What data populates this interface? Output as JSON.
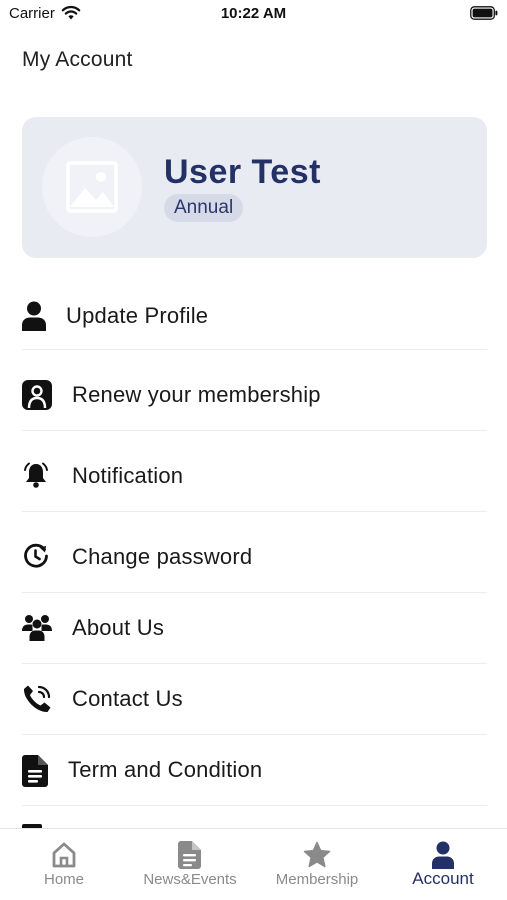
{
  "status_bar": {
    "carrier": "Carrier",
    "time": "10:22 AM"
  },
  "page": {
    "title": "My Account"
  },
  "profile": {
    "name": "User Test",
    "plan": "Annual"
  },
  "menu": {
    "items": [
      {
        "label": "Update Profile",
        "icon": "person-icon"
      },
      {
        "label": "Renew your membership",
        "icon": "membership-card-icon"
      },
      {
        "label": "Notification",
        "icon": "bell-icon"
      },
      {
        "label": "Change password",
        "icon": "clock-refresh-icon"
      },
      {
        "label": "About Us",
        "icon": "people-group-icon"
      },
      {
        "label": "Contact Us",
        "icon": "phone-icon"
      },
      {
        "label": "Term and Condition",
        "icon": "document-icon"
      }
    ]
  },
  "tabs": [
    {
      "label": "Home",
      "icon": "home-icon",
      "active": false
    },
    {
      "label": "News&Events",
      "icon": "document-icon",
      "active": false
    },
    {
      "label": "Membership",
      "icon": "star-icon",
      "active": false
    },
    {
      "label": "Account",
      "icon": "person-icon",
      "active": true
    }
  ],
  "colors": {
    "accent": "#243166",
    "card_bg": "#e9ebf2",
    "badge_bg": "#d6d9e8",
    "inactive_tab": "#8a8a8a"
  }
}
